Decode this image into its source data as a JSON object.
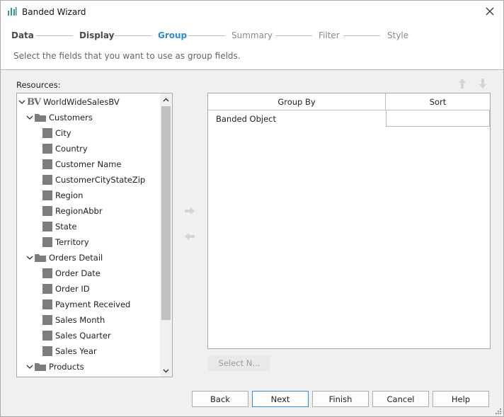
{
  "window": {
    "title": "Banded Wizard"
  },
  "steps": [
    {
      "label": "Data",
      "state": "done"
    },
    {
      "label": "Display",
      "state": "done"
    },
    {
      "label": "Group",
      "state": "active"
    },
    {
      "label": "Summary",
      "state": "future"
    },
    {
      "label": "Filter",
      "state": "future"
    },
    {
      "label": "Style",
      "state": "future"
    }
  ],
  "instruction": "Select the fields that you want to use as group fields.",
  "resources": {
    "label": "Resources:",
    "root": "WorldWideSalesBV",
    "customers": {
      "label": "Customers",
      "fields": [
        "City",
        "Country",
        "Customer Name",
        "CustomerCityStateZip",
        "Region",
        "RegionAbbr",
        "State",
        "Territory"
      ]
    },
    "orders": {
      "label": "Orders Detail",
      "fields": [
        "Order Date",
        "Order ID",
        "Payment Received",
        "Sales Month",
        "Sales Quarter",
        "Sales Year"
      ]
    },
    "products": {
      "label": "Products"
    }
  },
  "group_table": {
    "headers": {
      "group_by": "Group By",
      "sort": "Sort"
    },
    "rows": [
      {
        "group_by": "Banded Object",
        "sort": ""
      }
    ]
  },
  "select_button": "Select N...",
  "buttons": {
    "back": "Back",
    "next": "Next",
    "finish": "Finish",
    "cancel": "Cancel",
    "help": "Help"
  },
  "colors": {
    "accent": "#2f8dd0",
    "field_icon": "#7d7d7d",
    "app_icon": "#3aa53a"
  },
  "icons": {
    "app": "wizard-bars-icon",
    "close": "close-icon",
    "expand": "chevron-down-icon",
    "folder": "folder-icon",
    "field": "field-icon",
    "move_up": "arrow-up-icon",
    "move_down": "arrow-down-icon",
    "add": "arrow-right-icon",
    "remove": "arrow-left-icon"
  }
}
